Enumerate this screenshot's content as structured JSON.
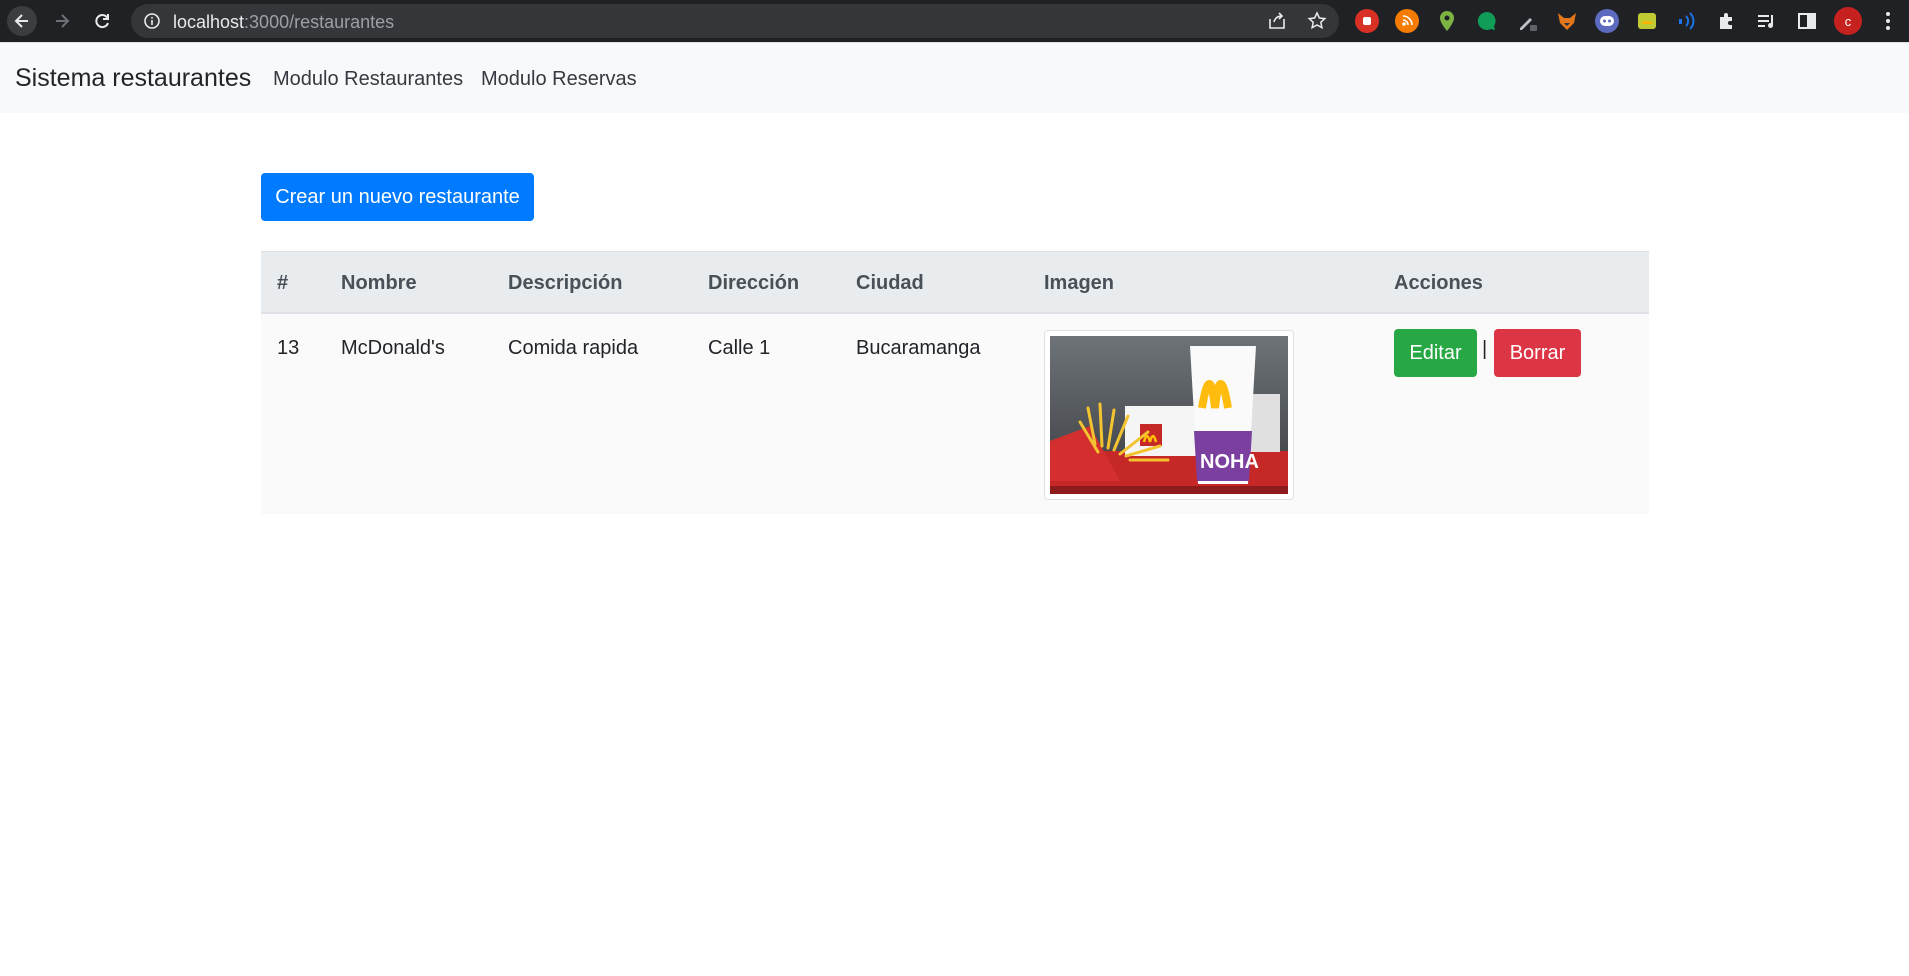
{
  "browser": {
    "url_host": "localhost",
    "url_path": ":3000/restaurantes",
    "profile_initial": "c"
  },
  "navbar": {
    "brand": "Sistema restaurantes",
    "links": [
      "Modulo Restaurantes",
      "Modulo Reservas"
    ]
  },
  "actions": {
    "create_label": "Crear un nuevo restaurante"
  },
  "table": {
    "headers": [
      "#",
      "Nombre",
      "Descripción",
      "Dirección",
      "Ciudad",
      "Imagen",
      "Acciones"
    ],
    "rows": [
      {
        "id": "13",
        "nombre": "McDonald's",
        "descripcion": "Comida rapida",
        "direccion": "Calle 1",
        "ciudad": "Bucaramanga",
        "edit_label": "Editar",
        "separator": "|",
        "delete_label": "Borrar"
      }
    ]
  },
  "colors": {
    "primary": "#007bff",
    "success": "#28a745",
    "danger": "#dc3545"
  }
}
